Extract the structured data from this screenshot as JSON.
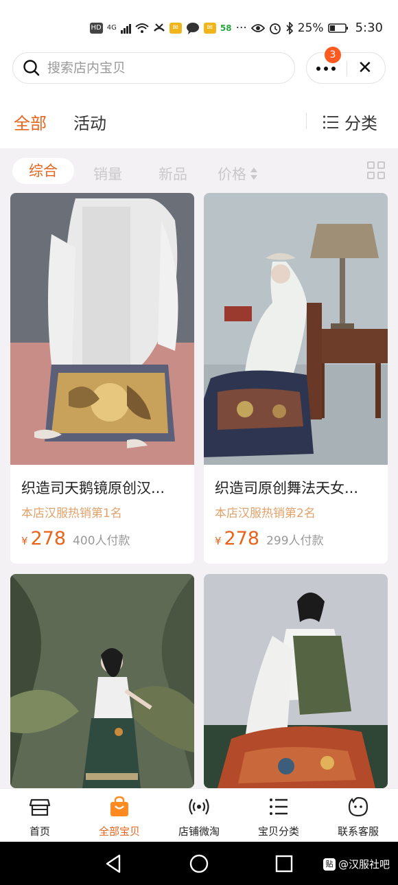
{
  "status_bar": {
    "network": "4G",
    "battery": "25%",
    "time": "5:30",
    "notif_badge": "58",
    "icons": [
      "hd-icon",
      "signal-icon",
      "wifi-icon",
      "missed-call-icon",
      "mail-icon",
      "chat-icon",
      "mail-icon",
      "ellipsis-icon",
      "eye-icon",
      "alarm-icon",
      "bluetooth-icon",
      "battery-icon"
    ]
  },
  "search": {
    "placeholder": "搜索店内宝贝",
    "value": ""
  },
  "capsule": {
    "badge_count": "3"
  },
  "top_tabs": {
    "all": "全部",
    "activity": "活动",
    "category": "分类"
  },
  "filters": {
    "overall": "综合",
    "sales": "销量",
    "new": "新品",
    "price": "价格"
  },
  "products": [
    {
      "title": "织造司天鹅镜原创汉...",
      "rank": "本店汉服热销第1名",
      "currency": "¥",
      "price": "278",
      "paid": "400人付款"
    },
    {
      "title": "织造司原创舞法天女...",
      "rank": "本店汉服热销第2名",
      "currency": "¥",
      "price": "278",
      "paid": "299人付款"
    },
    {
      "title": "",
      "rank": "",
      "currency": "",
      "price": "",
      "paid": ""
    },
    {
      "title": "",
      "rank": "",
      "currency": "",
      "price": "",
      "paid": ""
    }
  ],
  "bottom_nav": {
    "items": [
      {
        "label": "首页",
        "icon": "shop-icon"
      },
      {
        "label": "全部宝贝",
        "icon": "shopping-bag-icon"
      },
      {
        "label": "店铺微淘",
        "icon": "broadcast-icon"
      },
      {
        "label": "宝贝分类",
        "icon": "list-icon"
      },
      {
        "label": "联系客服",
        "icon": "chat-face-icon"
      }
    ]
  },
  "watermark": {
    "logo": "贴",
    "text": "@汉服社吧"
  },
  "colors": {
    "accent": "#e8631b",
    "rank": "#e0a26a",
    "badge": "#ff5a1f",
    "page_bg": "#f4f1f4"
  }
}
